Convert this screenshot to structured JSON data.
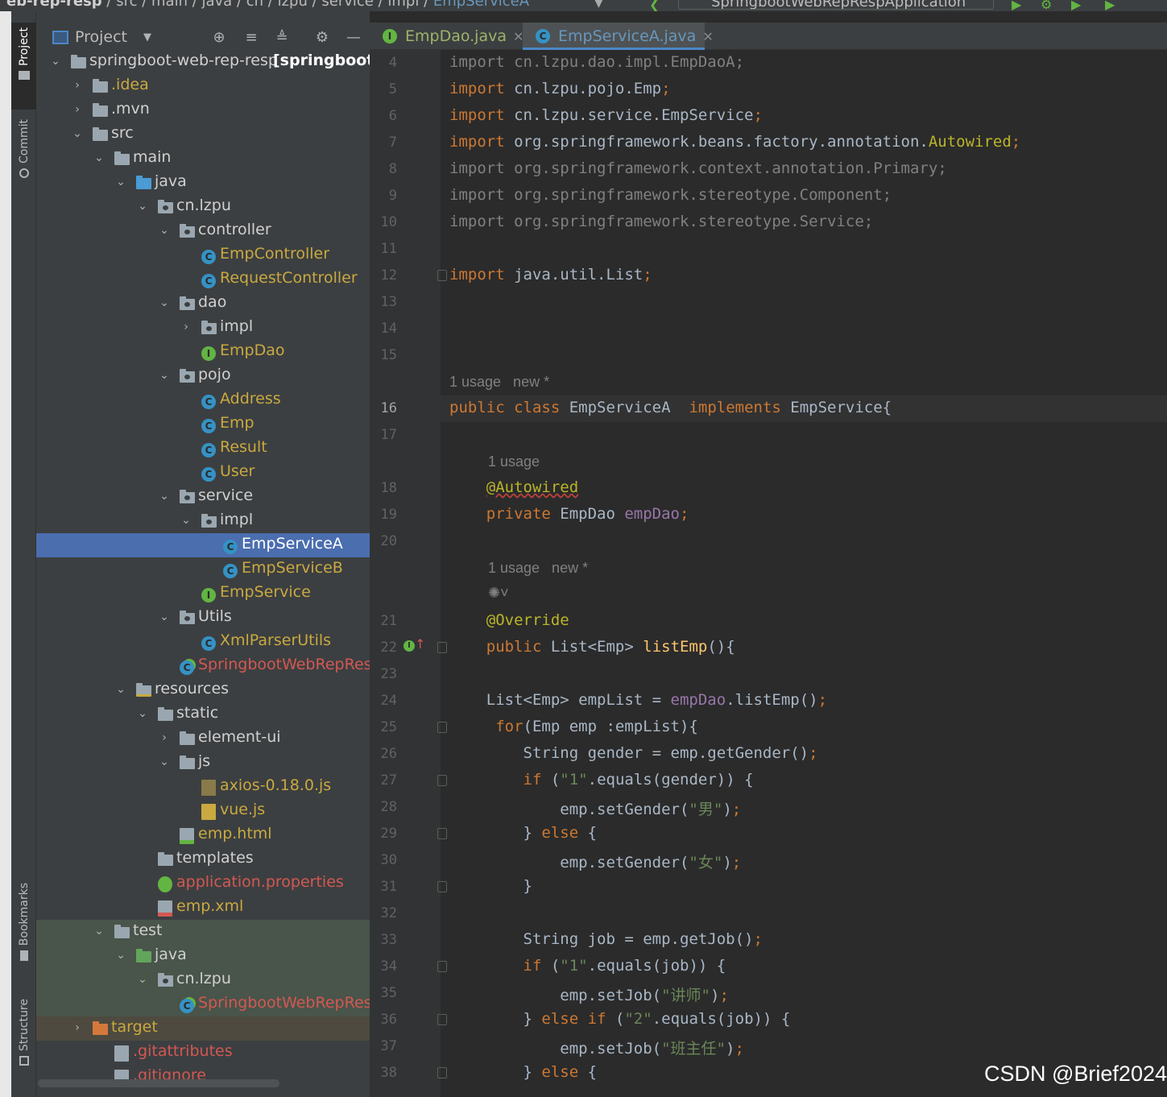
{
  "breadcrumbs": [
    "eb-rep-resp",
    "src",
    "main",
    "java",
    "cn",
    "lzpu",
    "service",
    "impl",
    "EmpServiceA"
  ],
  "run_config": "SpringbootWebRepRespApplication",
  "tool_windows": {
    "project": "Project",
    "commit": "Commit",
    "bookmarks": "Bookmarks",
    "structure": "Structure"
  },
  "project_panel": {
    "title": "Project",
    "icons": [
      "locate-icon",
      "expand-all-icon",
      "collapse-all-icon",
      "gear-icon",
      "minimize-icon"
    ]
  },
  "tree": [
    {
      "label": "springboot-web-rep-resp",
      "suffix": "[springboot-r",
      "depth": 0,
      "arrow": "down",
      "icon": "module",
      "color": "white"
    },
    {
      "label": ".idea",
      "depth": 1,
      "arrow": "right",
      "icon": "folder",
      "color": "yel"
    },
    {
      "label": ".mvn",
      "depth": 1,
      "arrow": "right",
      "icon": "folder",
      "color": "white"
    },
    {
      "label": "src",
      "depth": 1,
      "arrow": "down",
      "icon": "folder",
      "color": "white"
    },
    {
      "label": "main",
      "depth": 2,
      "arrow": "down",
      "icon": "folder",
      "color": "white"
    },
    {
      "label": "java",
      "depth": 3,
      "arrow": "down",
      "icon": "folder-blue",
      "color": "white"
    },
    {
      "label": "cn.lzpu",
      "depth": 4,
      "arrow": "down",
      "icon": "package",
      "color": "white"
    },
    {
      "label": "controller",
      "depth": 5,
      "arrow": "down",
      "icon": "package",
      "color": "white"
    },
    {
      "label": "EmpController",
      "depth": 6,
      "arrow": "",
      "icon": "class",
      "color": "yel"
    },
    {
      "label": "RequestController",
      "depth": 6,
      "arrow": "",
      "icon": "class",
      "color": "yel"
    },
    {
      "label": "dao",
      "depth": 5,
      "arrow": "down",
      "icon": "package",
      "color": "white"
    },
    {
      "label": "impl",
      "depth": 6,
      "arrow": "right",
      "icon": "package",
      "color": "white"
    },
    {
      "label": "EmpDao",
      "depth": 6,
      "arrow": "",
      "icon": "interface",
      "color": "yel"
    },
    {
      "label": "pojo",
      "depth": 5,
      "arrow": "down",
      "icon": "package",
      "color": "white"
    },
    {
      "label": "Address",
      "depth": 6,
      "arrow": "",
      "icon": "class",
      "color": "yel"
    },
    {
      "label": "Emp",
      "depth": 6,
      "arrow": "",
      "icon": "class",
      "color": "yel"
    },
    {
      "label": "Result",
      "depth": 6,
      "arrow": "",
      "icon": "class",
      "color": "yel"
    },
    {
      "label": "User",
      "depth": 6,
      "arrow": "",
      "icon": "class",
      "color": "yel"
    },
    {
      "label": "service",
      "depth": 5,
      "arrow": "down",
      "icon": "package",
      "color": "white"
    },
    {
      "label": "impl",
      "depth": 6,
      "arrow": "down",
      "icon": "package",
      "color": "white"
    },
    {
      "label": "EmpServiceA",
      "depth": 7,
      "arrow": "",
      "icon": "class",
      "color": "yel",
      "selected": true
    },
    {
      "label": "EmpServiceB",
      "depth": 7,
      "arrow": "",
      "icon": "class",
      "color": "yel"
    },
    {
      "label": "EmpService",
      "depth": 6,
      "arrow": "",
      "icon": "interface",
      "color": "yel"
    },
    {
      "label": "Utils",
      "depth": 5,
      "arrow": "down",
      "icon": "package",
      "color": "white"
    },
    {
      "label": "XmlParserUtils",
      "depth": 6,
      "arrow": "",
      "icon": "class",
      "color": "yel"
    },
    {
      "label": "SpringbootWebRepResp",
      "depth": 5,
      "arrow": "",
      "icon": "spring-class",
      "color": "red"
    },
    {
      "label": "resources",
      "depth": 3,
      "arrow": "down",
      "icon": "folder-res",
      "color": "white"
    },
    {
      "label": "static",
      "depth": 4,
      "arrow": "down",
      "icon": "folder",
      "color": "white"
    },
    {
      "label": "element-ui",
      "depth": 5,
      "arrow": "right",
      "icon": "folder",
      "color": "white"
    },
    {
      "label": "js",
      "depth": 5,
      "arrow": "down",
      "icon": "folder",
      "color": "white"
    },
    {
      "label": "axios-0.18.0.js",
      "depth": 6,
      "arrow": "",
      "icon": "js-min",
      "color": "yel"
    },
    {
      "label": "vue.js",
      "depth": 6,
      "arrow": "",
      "icon": "js",
      "color": "yel"
    },
    {
      "label": "emp.html",
      "depth": 5,
      "arrow": "",
      "icon": "html",
      "color": "yel"
    },
    {
      "label": "templates",
      "depth": 4,
      "arrow": "",
      "icon": "folder",
      "color": "white"
    },
    {
      "label": "application.properties",
      "depth": 4,
      "arrow": "",
      "icon": "properties",
      "color": "red"
    },
    {
      "label": "emp.xml",
      "depth": 4,
      "arrow": "",
      "icon": "xml",
      "color": "yel"
    },
    {
      "label": "test",
      "depth": 2,
      "arrow": "down",
      "icon": "folder",
      "color": "white",
      "bg": "test"
    },
    {
      "label": "java",
      "depth": 3,
      "arrow": "down",
      "icon": "folder-green",
      "color": "white",
      "bg": "test"
    },
    {
      "label": "cn.lzpu",
      "depth": 4,
      "arrow": "down",
      "icon": "package",
      "color": "white",
      "bg": "test"
    },
    {
      "label": "SpringbootWebRepResp",
      "depth": 5,
      "arrow": "",
      "icon": "spring-class",
      "color": "red",
      "bg": "test"
    },
    {
      "label": "target",
      "depth": 1,
      "arrow": "right",
      "icon": "folder-orange",
      "color": "yel",
      "bg": "target"
    },
    {
      "label": ".gitattributes",
      "depth": 2,
      "arrow": "",
      "icon": "file",
      "color": "red"
    },
    {
      "label": ".gitignore",
      "depth": 2,
      "arrow": "",
      "icon": "file-git",
      "color": "red"
    }
  ],
  "editor_tabs": [
    {
      "label": "EmpDao.java",
      "badge": "I",
      "active": false
    },
    {
      "label": "EmpServiceA.java",
      "badge": "C",
      "active": true
    }
  ],
  "code_lines": [
    {
      "n": "4",
      "html": "<span class=\"gray\">import cn.lzpu.dao.impl.EmpDaoA;</span>"
    },
    {
      "n": "5",
      "html": "<span class=\"kw\">import</span> cn.lzpu.pojo.Emp<span class=\"kw\">;</span>"
    },
    {
      "n": "6",
      "html": "<span class=\"kw\">import</span> cn.lzpu.service.EmpService<span class=\"kw\">;</span>"
    },
    {
      "n": "7",
      "html": "<span class=\"kw\">import</span> org.springframework.beans.factory.annotation.<span class=\"an\">Autowired</span><span class=\"kw\">;</span>"
    },
    {
      "n": "8",
      "html": "<span class=\"gray\">import org.springframework.context.annotation.Primary;</span>"
    },
    {
      "n": "9",
      "html": "<span class=\"gray\">import org.springframework.stereotype.Component;</span>"
    },
    {
      "n": "10",
      "html": "<span class=\"gray\">import org.springframework.stereotype.Service;</span>"
    },
    {
      "n": "11",
      "html": ""
    },
    {
      "n": "12",
      "html": "<span class=\"kw\">import</span> java.util.List<span class=\"kw\">;</span>"
    },
    {
      "n": "13",
      "html": ""
    },
    {
      "n": "14",
      "html": ""
    },
    {
      "n": "15",
      "html": ""
    }
  ],
  "inlay_hints": {
    "usage_new": "1 usage   new *",
    "usage": "1 usage"
  },
  "code_lines_b": [
    {
      "n": "16",
      "html": "<span class=\"kw\">public class</span> EmpServiceA  <span class=\"kw\">implements</span> EmpService{"
    },
    {
      "n": "17",
      "html": ""
    },
    {
      "n": "18",
      "html": "    <span class=\"an sq\">@Autowired</span>"
    },
    {
      "n": "19",
      "html": "    <span class=\"kw\">private</span> EmpDao <span class=\"fld\">empDao</span><span class=\"kw\">;</span>"
    },
    {
      "n": "20",
      "html": ""
    },
    {
      "n": "21",
      "html": "    <span class=\"an\">@Override</span>"
    },
    {
      "n": "22",
      "html": "    <span class=\"kw\">public</span> List&lt;Emp&gt; <span class=\"fn\">listEmp</span>(){"
    },
    {
      "n": "23",
      "html": ""
    },
    {
      "n": "24",
      "html": "    List&lt;Emp&gt; empList = <span class=\"fld\">empDao</span>.listEmp()<span class=\"kw\">;</span>"
    },
    {
      "n": "25",
      "html": "     <span class=\"kw\">for</span>(Emp emp :empList){"
    },
    {
      "n": "26",
      "html": "        String gender = emp.getGender()<span class=\"kw\">;</span>"
    },
    {
      "n": "27",
      "html": "        <span class=\"kw\">if</span> (<span class=\"str\">\"1\"</span>.equals(gender)) {"
    },
    {
      "n": "28",
      "html": "            emp.setGender(<span class=\"str\">\"男\"</span>)<span class=\"kw\">;</span>"
    },
    {
      "n": "29",
      "html": "        } <span class=\"kw\">else</span> {"
    },
    {
      "n": "30",
      "html": "            emp.setGender(<span class=\"str\">\"女\"</span>)<span class=\"kw\">;</span>"
    },
    {
      "n": "31",
      "html": "        }"
    },
    {
      "n": "32",
      "html": ""
    },
    {
      "n": "33",
      "html": "        String job = emp.getJob()<span class=\"kw\">;</span>"
    },
    {
      "n": "34",
      "html": "        <span class=\"kw\">if</span> (<span class=\"str\">\"1\"</span>.equals(job)) {"
    },
    {
      "n": "35",
      "html": "            emp.setJob(<span class=\"str\">\"讲师\"</span>)<span class=\"kw\">;</span>"
    },
    {
      "n": "36",
      "html": "        } <span class=\"kw\">else if</span> (<span class=\"str\">\"2\"</span>.equals(job)) {"
    },
    {
      "n": "37",
      "html": "            emp.setJob(<span class=\"str\">\"班主任\"</span>)<span class=\"kw\">;</span>"
    },
    {
      "n": "38",
      "html": "        } <span class=\"kw\">else</span> {"
    }
  ],
  "watermark": "CSDN @Brief2024",
  "colors": {
    "selection": "#4b6eaf",
    "keyword": "#cc7832",
    "annotation": "#bbb529",
    "field": "#9876aa",
    "string": "#6a8759",
    "method": "#ffc66d"
  }
}
